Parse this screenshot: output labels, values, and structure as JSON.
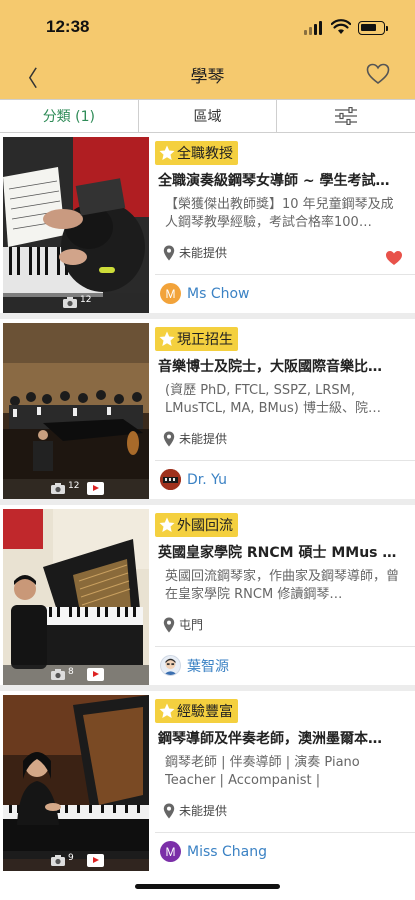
{
  "status_bar": {
    "time": "12:38"
  },
  "nav": {
    "back": "〈",
    "title": "學琴"
  },
  "tabs": [
    {
      "label": "分類 (1)",
      "active": true
    },
    {
      "label": "區域",
      "active": false
    },
    {
      "label": "",
      "icon": "filter-sliders-icon",
      "active": false
    }
  ],
  "listings": [
    {
      "tag": "全職教授",
      "title": "全職演奏級鋼琴女導師 ~ 學生考試…",
      "description": "【榮獲傑出教師獎】10 年兒童鋼琴及成人鋼琴教學經驗，考試合格率100…",
      "location": "未能提供",
      "author": "Ms Chow",
      "avatar_letter": "M",
      "avatar_color": "#f2a33a",
      "photo_count": "12",
      "has_video": false,
      "favorited": true
    },
    {
      "tag": "現正招生",
      "title": "音樂博士及院士，大阪國際音樂比…",
      "description": "(資歷 PhD, FTCL, SSPZ, LRSM, LMusTCL, MA, BMus) 博士級、院…",
      "location": "未能提供",
      "author": "Dr. Yu",
      "avatar_letter": "",
      "avatar_color": "#a0321e",
      "photo_count": "12",
      "has_video": true,
      "favorited": false
    },
    {
      "tag": "外國回流",
      "title": "英國皇家學院 RNCM 碩士 MMus 鋼…",
      "description": "英國回流鋼琴家，作曲家及鋼琴導師，曾在皇家學院 RNCM 修讀鋼琴…",
      "location": "屯門",
      "author": "葉智源",
      "avatar_letter": "",
      "avatar_color": "#e8eef6",
      "photo_count": "8",
      "has_video": true,
      "favorited": false
    },
    {
      "tag": "經驗豐富",
      "title": "鋼琴導師及伴奏老師，澳洲墨爾本…",
      "description": "鋼琴老師 | 伴奏導師 | 演奏 Piano Teacher | Accompanist | Performan…",
      "location": "未能提供",
      "author": "Miss Chang",
      "avatar_letter": "M",
      "avatar_color": "#7b2fa8",
      "photo_count": "9",
      "has_video": true,
      "favorited": false
    }
  ],
  "colors": {
    "header": "#f5c96e",
    "tag": "#f4d03f",
    "active_tab": "#2e8b57",
    "link": "#3b82c4",
    "favorite": "#e8524a"
  }
}
